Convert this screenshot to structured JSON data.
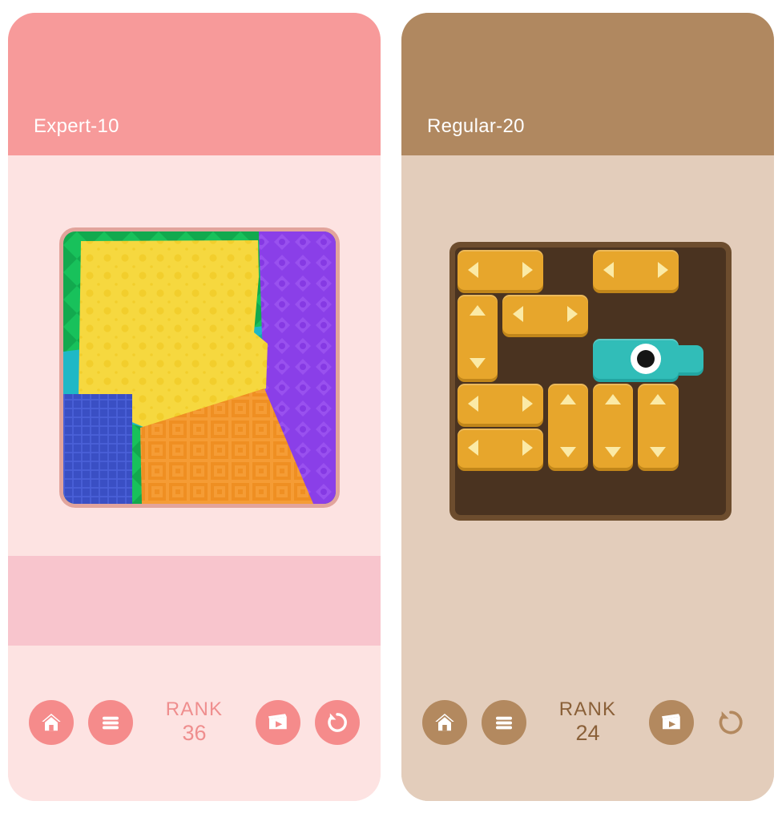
{
  "page": {
    "background": "#ffffff"
  },
  "panels": [
    {
      "id": "left",
      "title": "Expert-10",
      "theme": {
        "header_bg": "#f79a9a",
        "body_bg": "#fde3e2",
        "accent_band_bg": "#f8c5cd",
        "button_bg": "#f58b8b",
        "icon_color": "#ffffff",
        "rank_text_color": "#ef8e8e",
        "title_color": "#ffffff"
      },
      "toolbar": {
        "home_label": "home-button",
        "menu_label": "menu-button",
        "rank_label": "RANK",
        "rank_value": "36",
        "video_label": "watch-video-button",
        "restart_label": "restart-button"
      },
      "artwork": {
        "type": "tangram-puzzle-preview",
        "frame_color": "#e2a49c",
        "pieces": [
          {
            "name": "green",
            "color": "#12a94e",
            "pattern": "diamond"
          },
          {
            "name": "purple",
            "color": "#8a3fe8",
            "pattern": "diamond-dot"
          },
          {
            "name": "teal",
            "color": "#1fb8c6",
            "pattern": "plain"
          },
          {
            "name": "teal-dark",
            "color": "#1ba3ae",
            "pattern": "plain"
          },
          {
            "name": "yellow",
            "color": "#f6d83f",
            "pattern": "dot-grid"
          },
          {
            "name": "blue",
            "color": "#3a4fc4",
            "pattern": "plaid"
          },
          {
            "name": "orange",
            "color": "#f59c35",
            "pattern": "square-grid"
          }
        ]
      }
    },
    {
      "id": "right",
      "title": "Regular-20",
      "theme": {
        "header_bg": "#b08860",
        "body_bg": "#e3cdbb",
        "accent_band_bg": null,
        "button_bg": "#b3895f",
        "icon_color": "#ffffff",
        "rank_text_color": "#8a6038",
        "title_color": "#ffffff"
      },
      "toolbar": {
        "home_label": "home-button",
        "menu_label": "menu-button",
        "rank_label": "RANK",
        "rank_value": "24",
        "video_label": "watch-video-button",
        "restart_label": "restart-button"
      },
      "board": {
        "type": "slide-block-puzzle",
        "frame_color": "#6d4d2e",
        "cell_bg": "#4a3320",
        "block_color": "#e7a62c",
        "block_shadow": "#c1861a",
        "arrow_color": "#fbeaa6",
        "goal_color": "#31bdb8",
        "goal_shadow": "#23a5a1",
        "grid": {
          "cols": 6,
          "rows": 6
        },
        "blocks": [
          {
            "name": "block-h-1",
            "orientation": "horizontal",
            "col": 0,
            "row": 0,
            "len": 2
          },
          {
            "name": "block-h-2",
            "orientation": "horizontal",
            "col": 3,
            "row": 0,
            "len": 2
          },
          {
            "name": "block-v-1",
            "orientation": "vertical",
            "col": 0,
            "row": 1,
            "len": 2
          },
          {
            "name": "block-h-3",
            "orientation": "horizontal",
            "col": 1,
            "row": 1,
            "len": 2
          },
          {
            "name": "block-h-4",
            "orientation": "horizontal",
            "col": 0,
            "row": 3,
            "len": 2
          },
          {
            "name": "block-h-5",
            "orientation": "horizontal",
            "col": 0,
            "row": 4,
            "len": 2
          },
          {
            "name": "block-v-2",
            "orientation": "vertical",
            "col": 2,
            "row": 3,
            "len": 2
          },
          {
            "name": "block-v-3",
            "orientation": "vertical",
            "col": 3,
            "row": 3,
            "len": 2
          },
          {
            "name": "block-v-4",
            "orientation": "vertical",
            "col": 4,
            "row": 3,
            "len": 2
          }
        ],
        "goal_block": {
          "name": "goal-block",
          "orientation": "horizontal",
          "col": 3,
          "row": 2,
          "len": 2,
          "has_exit_tab": true
        }
      }
    }
  ]
}
